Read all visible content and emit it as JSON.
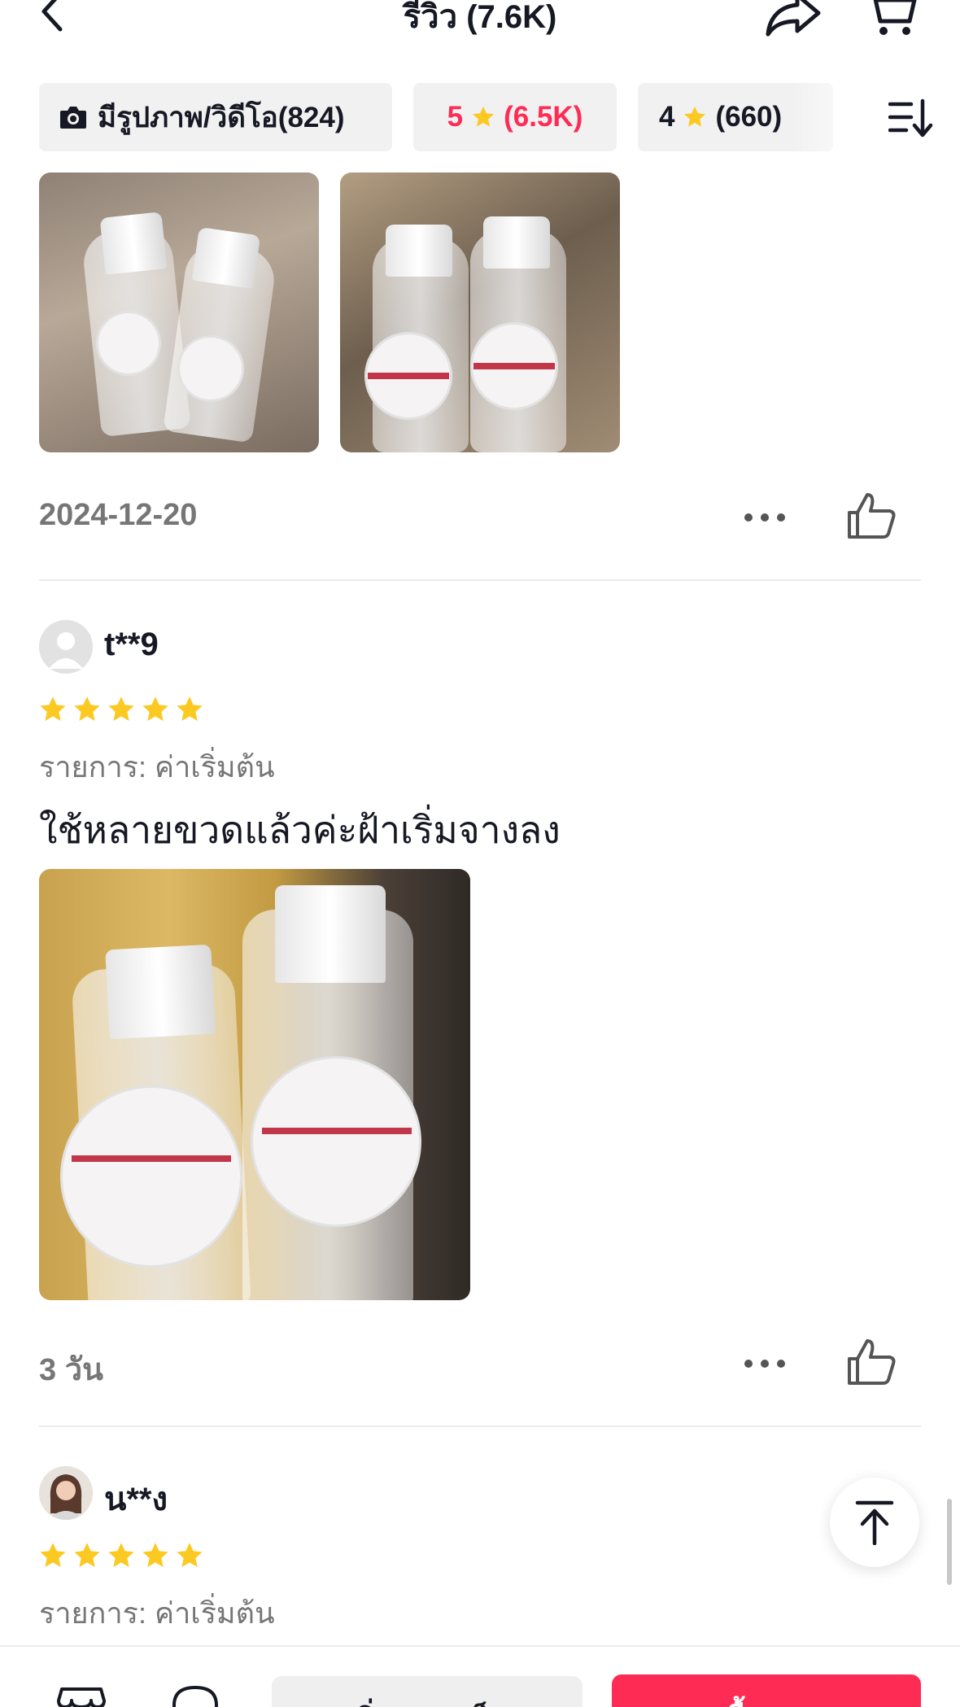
{
  "header": {
    "title": "รีวิว (7.6K)",
    "icons": [
      "back-icon",
      "share-icon",
      "cart-icon"
    ]
  },
  "filters": {
    "media": {
      "label": "มีรูปภาพ/วิดีโอ(824)",
      "icon": "camera-icon"
    },
    "five_star": {
      "rating": "5",
      "count": "(6.5K)",
      "active": true
    },
    "four_star": {
      "rating": "4",
      "count": "(660)"
    },
    "sort_icon": "sort-icon"
  },
  "reviews": [
    {
      "photos": 2,
      "date": "2024-12-20"
    },
    {
      "username": "t**9",
      "stars": 5,
      "variant": "รายการ: ค่าเริ่มต้น",
      "text": "ใช้หลายขวดแล้วค่ะฝ้าเริ่มจางลง",
      "photos": 1,
      "date": "3 วัน"
    },
    {
      "username": "น**ง",
      "stars": 5,
      "variant": "รายการ: ค่าเริ่มต้น"
    }
  ],
  "bottom_bar": {
    "cart_button": "เพิ่มลงรถเข็น",
    "buy_button": "ซื้อเลย"
  },
  "colors": {
    "accent": "#fe2c55",
    "star": "#fcc923",
    "muted_text": "#767676",
    "chip_bg": "#f1f1f2"
  }
}
